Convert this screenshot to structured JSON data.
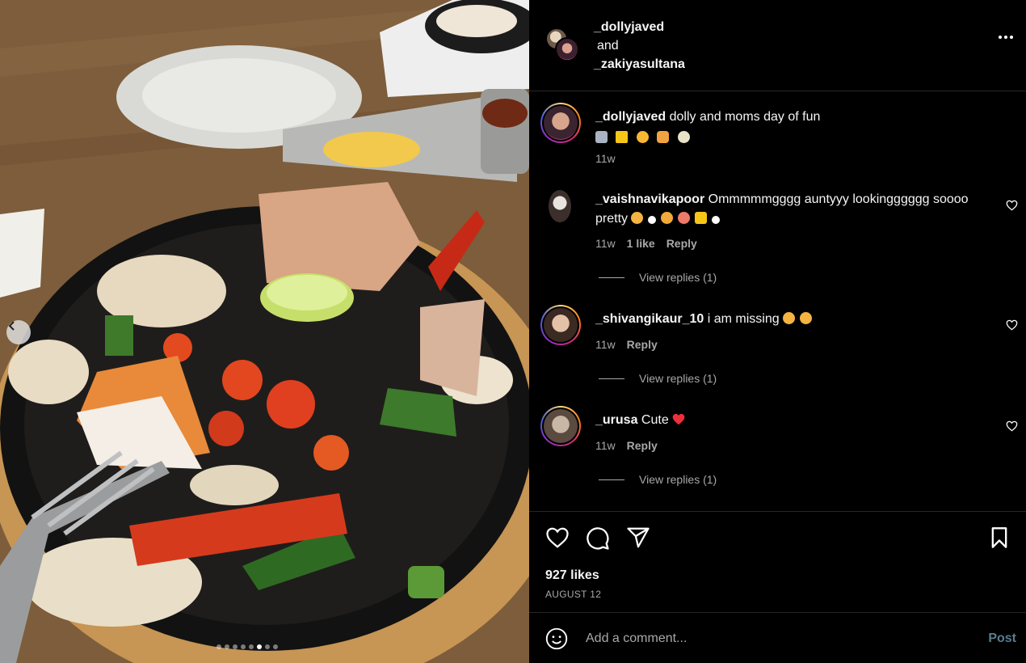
{
  "photo": {
    "carousel_dots": 8,
    "active_dot": 6
  },
  "header": {
    "user1": "_dollyjaved",
    "and": "and",
    "user2": "_zakiyasultana"
  },
  "caption": {
    "username": "_dollyjaved",
    "text": "dolly and moms day of fun",
    "time": "11w"
  },
  "comments": [
    {
      "username": "_vaishnavikapoor",
      "text": "Ommmmmgggg auntyyy lookingggggg soooo pretty",
      "time": "11w",
      "likes": "1 like",
      "reply": "Reply",
      "view_replies": "View replies (1)"
    },
    {
      "username": "_shivangikaur_10",
      "text": "i am missing",
      "time": "11w",
      "reply": "Reply",
      "view_replies": "View replies (1)"
    },
    {
      "username": "_urusa",
      "text": "Cute",
      "time": "11w",
      "reply": "Reply",
      "view_replies": "View replies (1)"
    }
  ],
  "likes": "927 likes",
  "date": "AUGUST 12",
  "add_comment": {
    "placeholder": "Add a comment...",
    "post_label": "Post"
  },
  "colors": {
    "background": "#000000",
    "muted": "#a8a8a8",
    "post_button": "#5a7c8f",
    "divider": "#262626"
  }
}
